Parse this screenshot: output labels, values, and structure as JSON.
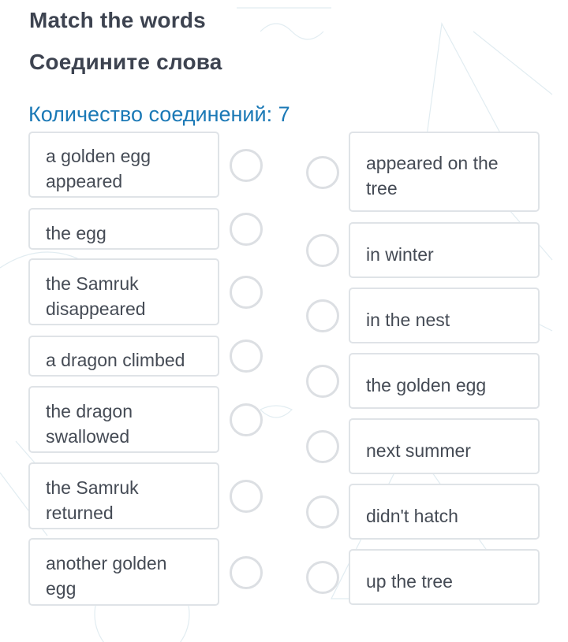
{
  "header": {
    "title_en": "Match the words",
    "title_ru": "Соедините слова",
    "connections_label": "Количество соединений: 7"
  },
  "left_items": [
    "a golden egg appeared",
    "the egg",
    "the Samruk disappeared",
    "a dragon climbed",
    "the dragon swallowed",
    "the Samruk returned",
    "another golden egg"
  ],
  "right_items": [
    "appeared on the tree",
    "in winter",
    "in the nest",
    "the golden egg",
    "next summer",
    "didn't hatch",
    "up the tree"
  ],
  "colors": {
    "title": "#3d4350",
    "accent": "#1b79b6",
    "card_border": "#dfe3e7",
    "connector_border": "#dcdfe3"
  }
}
